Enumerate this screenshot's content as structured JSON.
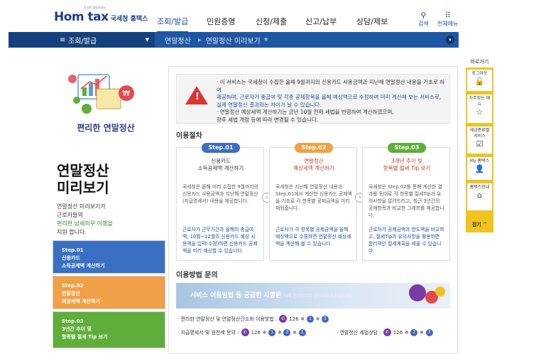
{
  "header": {
    "logo_main": "Hom  tax",
    "logo_small": "국세청 홈택스",
    "logo_tiny": "안녕한 걸림서비스",
    "nav": [
      "조회/발급",
      "민원증명",
      "신청/제출",
      "신고/납부",
      "상담/제보"
    ],
    "search_label": "검색",
    "menu_label": "전체메뉴"
  },
  "breadcrumb": {
    "section": "조회/발급",
    "item1": "연말정산",
    "item2": "연말정산 미리보기"
  },
  "left": {
    "promo_title": "편리한 연말정산",
    "big_title_1": "연말정산",
    "big_title_2": "미리보기",
    "desc_1": "연말정산 미리보기가",
    "desc_2": "근로자들의",
    "desc_3": "편리한 납세의무 이행을",
    "desc_4": "지원 합니다.",
    "steps": [
      {
        "label": "Step.01",
        "text": "신용카드",
        "text2": "소득공제액 계산하기",
        "color": "#3a6fc1"
      },
      {
        "label": "Step.02",
        "text": "연말정산",
        "text2": "예상세액 계산하기",
        "color": "#f0a046"
      },
      {
        "label": "Step.03",
        "text": "3년간 추이 및",
        "text2": "항목별 절세 Tip 보기",
        "color": "#5fae3a"
      }
    ]
  },
  "notice": {
    "line1": "· 이 서비스는 국세청이 수집한 올해 9월까지의 신용카드 사용금액과 지난해 연말정산 내용을 기초로 하여",
    "line2": "제공하며, 근로자가 총급여 및 각종 공제항목을 올해 예상액으로 수정하여 미리 계산해 보는 서비스로,",
    "line3": "실제 연말정산 결과와는 차이가 날 수 있습니다.",
    "line4": "· 연말정산 예상세액 계산하기는 금년 10월 현재 세법을 반영하여 계산하였으며,",
    "line5": "향후 세법 개정 등에 따라 변경될 수 있습니다."
  },
  "procedure": {
    "heading": "이용절차",
    "cards": [
      {
        "badge": "Step.01",
        "badge_color": "#3a6fc1",
        "title1": "신용카드",
        "title2": "소득공제액 계산하기",
        "body": "국세청은 올해 미리 수집한 9월까지의 신용카드 사용금액과 지난해 연말정산(지급명세서) 내용을 제공합니다.",
        "blue": "근로자가 근무기간과 올해의 총급여액, 10월~12월의 신용카드 예상 사용액을 입력(수정)하면 신용카드 공제액을 미리 예상할 수 있습니다."
      },
      {
        "badge": "Step.02",
        "badge_color": "#f0a046",
        "title1": "연말정산",
        "title2": "예상세액 계산하기",
        "body": "국세청은 지난해 연말정산 내용과 Step.01에서 계산한 신용카드 공제액을 기초로 각 항목별 공제금액을 미리 채워줍니다.",
        "blue": "근로자가 각 항목별 공제금액을 올해예상액으로 수정하면 연말정산 예상세액을 계산해 볼 수 있습니다."
      },
      {
        "badge": "Step.03",
        "badge_color": "#5fae3a",
        "title1": "3개년 추이 및",
        "title2": "항목별 절세 Tip 보기",
        "body": "국세청은 Step.02를 통해 계산한 결과를 토대로 각 항목별 절세Tip과 유의사항을 알려드리고, 최근 3년간의 공제항목과 비교한 그래프를 제공합니다.",
        "blue": "근로자가 공제금액과 한도액을 비교하고, 절세Tip과 유의사항을 활용하면 합리적인 절세계획을 세울 수 있습니다."
      }
    ]
  },
  "inquiry": {
    "heading": "이용방법 문의",
    "banner_main": "서비스 이용방법 등 궁금한 사항은",
    "banner_sub": "아래 전화번호로 문의하시기 바랍니다.",
    "line1_label": "· 편리한 연말정산 및 연말정산간소화 이용방법 :",
    "line1_num": "126",
    "line1_dots": [
      "1",
      "5"
    ],
    "line2_label": "· 지급명세서 및 원천세 문의 :",
    "line2_num": "126",
    "line2_dots": [
      "1",
      "3",
      "2"
    ],
    "line3_label": "· 연말정산 세법상담 :",
    "line3_num": "126",
    "line3_dots": [
      "2",
      "3"
    ]
  },
  "quick": {
    "heading": "바로가기",
    "items": [
      "로그아웃",
      "자주찾는 메뉴",
      "세금종류별 서비스",
      "My 홈택스",
      "홈택스안내"
    ],
    "close": "접기 ^"
  }
}
